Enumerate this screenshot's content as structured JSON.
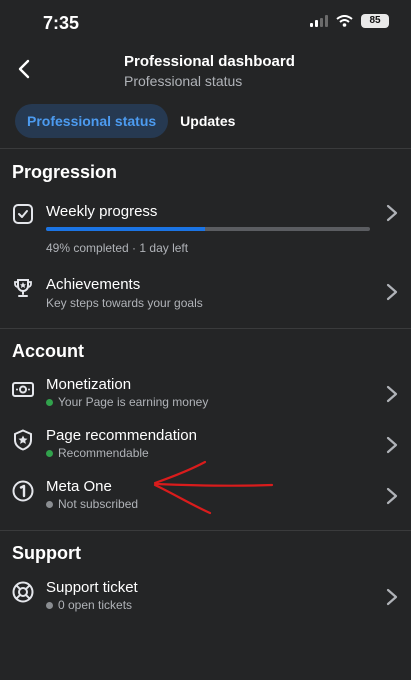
{
  "status_bar": {
    "time": "7:35",
    "battery": "85"
  },
  "header": {
    "title": "Professional dashboard",
    "subtitle": "Professional status"
  },
  "tabs": [
    {
      "label": "Professional status",
      "active": true
    },
    {
      "label": "Updates",
      "active": false
    }
  ],
  "sections": {
    "progression": "Progression",
    "account": "Account",
    "support": "Support"
  },
  "progression": {
    "weekly": {
      "title": "Weekly progress",
      "progress_percent": 49,
      "caption": "49% completed · 1 day left"
    },
    "achievements": {
      "title": "Achievements",
      "subtitle": "Key steps towards your goals"
    }
  },
  "account": {
    "monetization": {
      "title": "Monetization",
      "status": "Your Page is earning money",
      "status_color": "#31a24c"
    },
    "recommendation": {
      "title": "Page recommendation",
      "status": "Recommendable",
      "status_color": "#31a24c"
    },
    "meta_one": {
      "title": "Meta One",
      "status": "Not subscribed",
      "status_color": "#8a8d91"
    }
  },
  "support": {
    "ticket": {
      "title": "Support ticket",
      "status": "0 open tickets",
      "status_color": "#8a8d91"
    }
  },
  "colors": {
    "accent": "#1b74e4",
    "background": "#242526",
    "annotation": "#d91c1c"
  }
}
